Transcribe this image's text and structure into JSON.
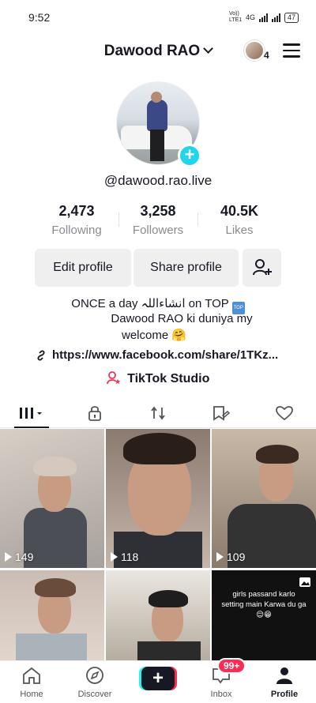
{
  "status_bar": {
    "time": "9:52",
    "network": "Vo)) LTE1",
    "signal_label": "4G",
    "battery": "47"
  },
  "header": {
    "username": "Dawood RAO",
    "friends_count": "4"
  },
  "profile": {
    "handle": "@dawood.rao.live",
    "stats": [
      {
        "value": "2,473",
        "label": "Following"
      },
      {
        "value": "3,258",
        "label": "Followers"
      },
      {
        "value": "40.5K",
        "label": "Likes"
      }
    ],
    "buttons": {
      "edit": "Edit profile",
      "share": "Share profile"
    },
    "bio_line1": "ONCE a day انشاءاللہ on TOP",
    "bio_top_emoji": "TOP",
    "bio_line2": "Dawood RAO ki duniya my",
    "bio_line3": "welcome 🤗",
    "link": "https://www.facebook.com/share/1TKz...",
    "studio": "TikTok Studio"
  },
  "tabs": [
    {
      "icon": "grid-icon",
      "active": true
    },
    {
      "icon": "lock-icon"
    },
    {
      "icon": "repost-icon"
    },
    {
      "icon": "saved-icon"
    },
    {
      "icon": "heart-icon"
    }
  ],
  "videos": [
    {
      "views": "149"
    },
    {
      "views": "118"
    },
    {
      "views": "109"
    },
    {
      "views": ""
    },
    {
      "views": ""
    },
    {
      "caption_line1": "girls passand karlo",
      "caption_line2": "setting main Karwa du ga",
      "caption_emoji": "😌😁"
    }
  ],
  "nav": {
    "home": "Home",
    "discover": "Discover",
    "inbox": "Inbox",
    "inbox_badge": "99+",
    "profile": "Profile"
  },
  "colors": {
    "accent_cyan": "#20d5ec",
    "accent_red": "#fe2c55",
    "text": "#161823",
    "muted": "#8a8b91"
  }
}
